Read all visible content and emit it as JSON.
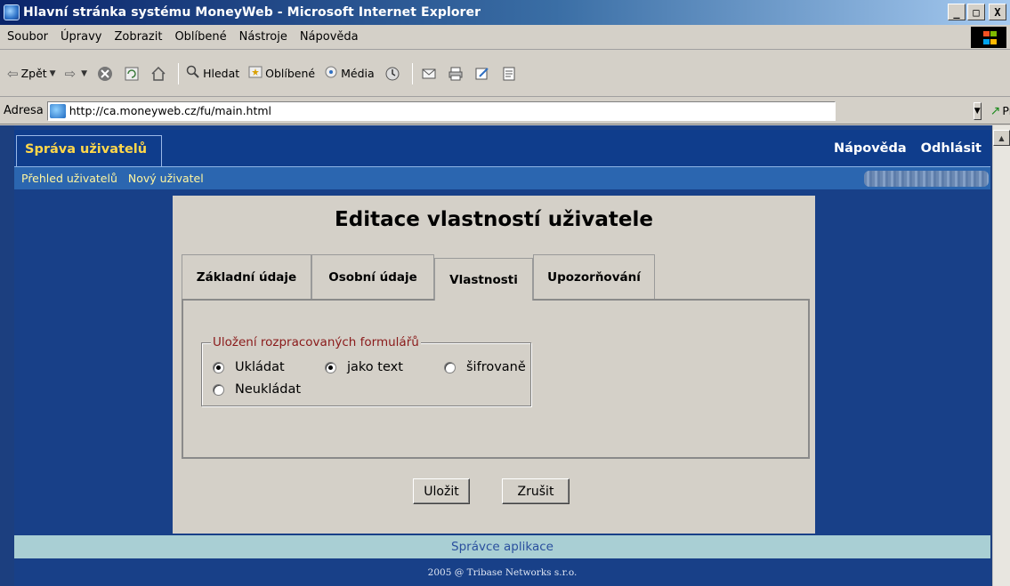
{
  "window": {
    "title": "Hlavní stránka systému MoneyWeb - Microsoft Internet Explorer",
    "controls": [
      "_",
      "□",
      "X"
    ]
  },
  "menu": [
    "Soubor",
    "Úpravy",
    "Zobrazit",
    "Oblíbené",
    "Nástroje",
    "Nápověda"
  ],
  "toolbar": {
    "back": "Zpět",
    "search": "Hledat",
    "favorites": "Oblíbené",
    "media": "Média"
  },
  "address": {
    "label": "Adresa",
    "url": "http://ca.moneyweb.cz/fu/main.html",
    "go": "Přejít"
  },
  "app": {
    "module_tab": "Správa uživatelů",
    "help": "Nápověda",
    "logout": "Odhlásit",
    "subnav": [
      "Přehled uživatelů",
      "Nový uživatel"
    ]
  },
  "form": {
    "title": "Editace vlastností uživatele",
    "tabs": [
      "Základní údaje",
      "Osobní údaje",
      "Vlastnosti",
      "Upozorňování"
    ],
    "active_tab": "Vlastnosti",
    "fieldset_legend": "Uložení rozpracovaných formulářů",
    "options": {
      "save": "Ukládat",
      "as_text": "jako text",
      "encrypted": "šifrovaně",
      "dont_save": "Neukládat"
    },
    "selected": [
      "Ukládat",
      "jako text"
    ],
    "save_button": "Uložit",
    "cancel_button": "Zrušit"
  },
  "footer": {
    "admin": "Správce aplikace",
    "copyright": "2005 @ Tribase Networks s.r.o."
  }
}
